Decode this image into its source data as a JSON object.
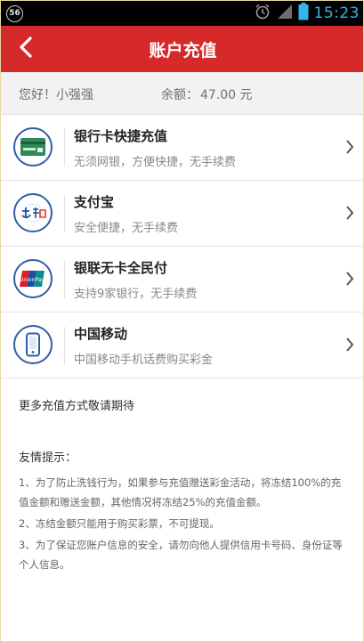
{
  "status_bar": {
    "badge": "56",
    "time": "15:23",
    "icons": [
      "alarm-icon",
      "signal-icon",
      "battery-icon"
    ]
  },
  "header": {
    "title": "账户充值",
    "back_icon": "back-arrow-icon",
    "bg_color": "#d62a2a"
  },
  "account": {
    "greeting": "您好！小强强",
    "balance_label": "余额：",
    "balance_value": "47.00 元"
  },
  "payment_methods": [
    {
      "name": "银行卡快捷充值",
      "desc": "无须网银，方便快捷，无手续费",
      "icon": "bank-card-icon"
    },
    {
      "name": "支付宝",
      "desc": "安全便捷，无手续费",
      "icon": "alipay-icon"
    },
    {
      "name": "银联无卡全民付",
      "desc": "支持9家银行，无手续费",
      "icon": "unionpay-icon"
    },
    {
      "name": "中国移动",
      "desc": "中国移动手机话费购买彩金",
      "icon": "mobile-phone-icon"
    }
  ],
  "more_text": "更多充值方式敬请期待",
  "tips": {
    "title": "友情提示：",
    "items": [
      "1、为了防止洗钱行为，如果参与充值赠送彩金活动，将冻结100%的充值金额和赠送金额，其他情况将冻结25%的充值金额。",
      "2、冻结金额只能用于购买彩票，不可提现。",
      "3、为了保证您账户信息的安全，请勿向他人提供信用卡号码、身份证等个人信息。"
    ]
  }
}
